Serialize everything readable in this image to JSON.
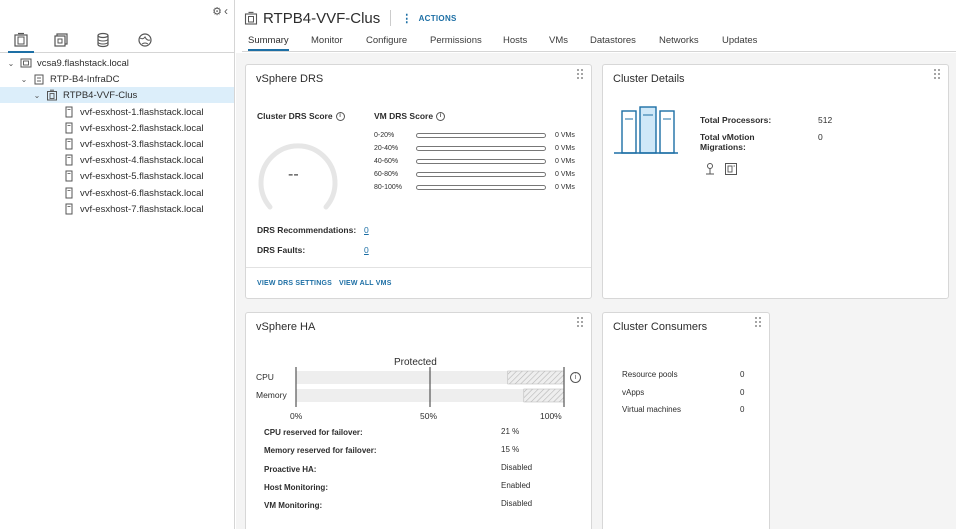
{
  "nav": {
    "tree": [
      {
        "label": "vcsa9.flashstack.local",
        "level": 0,
        "expanded": true,
        "icon": "vcenter-icon"
      },
      {
        "label": "RTP-B4-InfraDC",
        "level": 1,
        "expanded": true,
        "icon": "datacenter-icon"
      },
      {
        "label": "RTPB4-VVF-Clus",
        "level": 2,
        "expanded": true,
        "icon": "cluster-icon",
        "selected": true
      },
      {
        "label": "vvf-esxhost-1.flashstack.local",
        "level": 3,
        "icon": "host-icon"
      },
      {
        "label": "vvf-esxhost-2.flashstack.local",
        "level": 3,
        "icon": "host-icon"
      },
      {
        "label": "vvf-esxhost-3.flashstack.local",
        "level": 3,
        "icon": "host-icon"
      },
      {
        "label": "vvf-esxhost-4.flashstack.local",
        "level": 3,
        "icon": "host-icon"
      },
      {
        "label": "vvf-esxhost-5.flashstack.local",
        "level": 3,
        "icon": "host-icon"
      },
      {
        "label": "vvf-esxhost-6.flashstack.local",
        "level": 3,
        "icon": "host-icon"
      },
      {
        "label": "vvf-esxhost-7.flashstack.local",
        "level": 3,
        "icon": "host-icon"
      }
    ]
  },
  "header": {
    "title": "RTPB4-VVF-Clus",
    "actions_label": "ACTIONS"
  },
  "tabs": [
    {
      "label": "Summary",
      "active": true
    },
    {
      "label": "Monitor"
    },
    {
      "label": "Configure"
    },
    {
      "label": "Permissions"
    },
    {
      "label": "Hosts"
    },
    {
      "label": "VMs"
    },
    {
      "label": "Datastores"
    },
    {
      "label": "Networks"
    },
    {
      "label": "Updates"
    }
  ],
  "drs": {
    "title": "vSphere DRS",
    "cluster_score_label": "Cluster DRS Score",
    "cluster_score_value": "--",
    "vm_score_label": "VM DRS Score",
    "vm_ranges": [
      {
        "range": "0-20%",
        "count": "0 VMs"
      },
      {
        "range": "20-40%",
        "count": "0 VMs"
      },
      {
        "range": "40-60%",
        "count": "0 VMs"
      },
      {
        "range": "60-80%",
        "count": "0 VMs"
      },
      {
        "range": "80-100%",
        "count": "0 VMs"
      }
    ],
    "recommendations_label": "DRS Recommendations:",
    "recommendations_value": "0",
    "faults_label": "DRS Faults:",
    "faults_value": "0",
    "link_settings": "VIEW DRS SETTINGS",
    "link_vms": "VIEW ALL VMS"
  },
  "details": {
    "title": "Cluster Details",
    "total_processors_label": "Total Processors:",
    "total_processors_value": "512",
    "vmotion_label_1": "Total vMotion",
    "vmotion_label_2": "Migrations:",
    "vmotion_value": "0"
  },
  "ha": {
    "title": "vSphere HA",
    "protected_label": "Protected",
    "cpu_label": "CPU",
    "memory_label": "Memory",
    "cpu_reserved_fraction": 0.21,
    "memory_reserved_fraction": 0.15,
    "axis": [
      "0%",
      "50%",
      "100%"
    ],
    "rows": [
      {
        "label": "CPU reserved for failover:",
        "value": "21 %"
      },
      {
        "label": "Memory reserved for failover:",
        "value": "15 %"
      },
      {
        "label": "Proactive HA:",
        "value": "Disabled"
      },
      {
        "label": "Host Monitoring:",
        "value": "Enabled"
      },
      {
        "label": "VM Monitoring:",
        "value": "Disabled"
      }
    ]
  },
  "consumers": {
    "title": "Cluster Consumers",
    "rows": [
      {
        "label": "Resource pools",
        "value": "0"
      },
      {
        "label": "vApps",
        "value": "0"
      },
      {
        "label": "Virtual machines",
        "value": "0"
      }
    ]
  },
  "colors": {
    "accent": "#1d6fa5",
    "selected_bg": "#dceefa",
    "icon_blue": "#1d6fa5"
  }
}
